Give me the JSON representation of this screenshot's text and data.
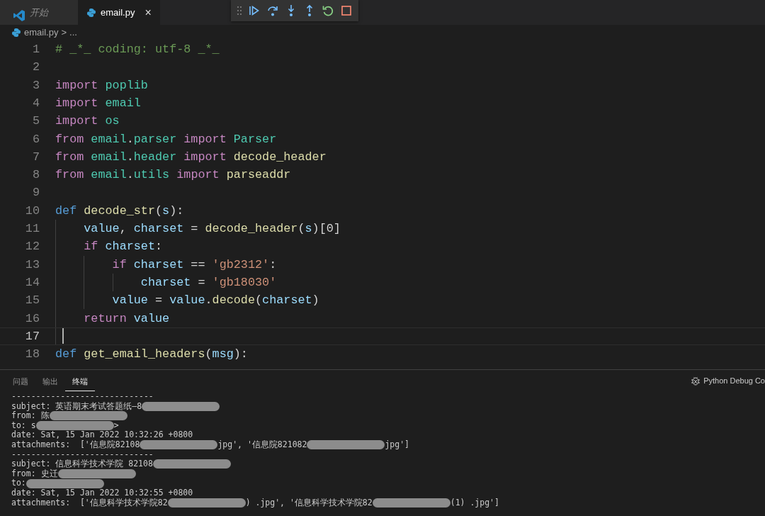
{
  "tabs": [
    {
      "label": "开始",
      "kind": "welcome",
      "selected": false
    },
    {
      "label": "email.py",
      "kind": "python",
      "selected": true,
      "close": "×"
    }
  ],
  "breadcrumb": {
    "file": "email.py",
    "separator": ">",
    "more": "..."
  },
  "editor": {
    "lines": [
      {
        "number": "1",
        "current": false,
        "tokens": [
          {
            "text": "# _*_ coding: utf-8 _*_",
            "kind": "comment"
          }
        ]
      },
      {
        "number": "2",
        "current": false
      },
      {
        "number": "3",
        "current": false,
        "tokens": [
          {
            "text": "import ",
            "kind": "keyword"
          },
          {
            "text": "poplib",
            "kind": "module"
          }
        ]
      },
      {
        "number": "4",
        "current": false,
        "tokens": [
          {
            "text": "import ",
            "kind": "keyword"
          },
          {
            "text": "email",
            "kind": "module"
          }
        ]
      },
      {
        "number": "5",
        "current": false,
        "tokens": [
          {
            "text": "import ",
            "kind": "keyword"
          },
          {
            "text": "os",
            "kind": "module"
          }
        ]
      },
      {
        "number": "6",
        "current": false,
        "tokens": [
          {
            "text": "from ",
            "kind": "keyword"
          },
          {
            "text": "email",
            "kind": "module"
          },
          {
            "text": ".",
            "kind": "plain"
          },
          {
            "text": "parser ",
            "kind": "module"
          },
          {
            "text": "import ",
            "kind": "keyword"
          },
          {
            "text": "Parser",
            "kind": "module"
          }
        ]
      },
      {
        "number": "7",
        "current": false,
        "tokens": [
          {
            "text": "from ",
            "kind": "keyword"
          },
          {
            "text": "email",
            "kind": "module"
          },
          {
            "text": ".",
            "kind": "plain"
          },
          {
            "text": "header ",
            "kind": "module"
          },
          {
            "text": "import ",
            "kind": "keyword"
          },
          {
            "text": "decode_header",
            "kind": "function"
          }
        ]
      },
      {
        "number": "8",
        "current": false,
        "tokens": [
          {
            "text": "from ",
            "kind": "keyword"
          },
          {
            "text": "email",
            "kind": "module"
          },
          {
            "text": ".",
            "kind": "plain"
          },
          {
            "text": "utils ",
            "kind": "module"
          },
          {
            "text": "import ",
            "kind": "keyword"
          },
          {
            "text": "parseaddr",
            "kind": "function"
          }
        ]
      },
      {
        "number": "9",
        "current": false
      },
      {
        "number": "10",
        "current": false,
        "tokens": [
          {
            "text": "def ",
            "kind": "storage"
          },
          {
            "text": "decode_str",
            "kind": "function"
          },
          {
            "text": "(",
            "kind": "plain"
          },
          {
            "text": "s",
            "kind": "variable"
          },
          {
            "text": "):",
            "kind": "plain"
          }
        ]
      },
      {
        "number": "11",
        "current": false,
        "tokens": [
          {
            "text": "    value",
            "kind": "variable"
          },
          {
            "text": ", ",
            "kind": "plain"
          },
          {
            "text": "charset",
            "kind": "variable"
          },
          {
            "text": " = ",
            "kind": "plain"
          },
          {
            "text": "decode_header",
            "kind": "function"
          },
          {
            "text": "(",
            "kind": "plain"
          },
          {
            "text": "s",
            "kind": "variable"
          },
          {
            "text": ")[0]",
            "kind": "plain"
          }
        ]
      },
      {
        "number": "12",
        "current": false,
        "tokens": [
          {
            "text": "    if ",
            "kind": "keyword"
          },
          {
            "text": "charset",
            "kind": "variable"
          },
          {
            "text": ":",
            "kind": "plain"
          }
        ]
      },
      {
        "number": "13",
        "current": false,
        "tokens": [
          {
            "text": "        if ",
            "kind": "keyword"
          },
          {
            "text": "charset",
            "kind": "variable"
          },
          {
            "text": " == ",
            "kind": "plain"
          },
          {
            "text": "'gb2312'",
            "kind": "string"
          },
          {
            "text": ":",
            "kind": "plain"
          }
        ]
      },
      {
        "number": "14",
        "current": false,
        "tokens": [
          {
            "text": "            charset",
            "kind": "variable"
          },
          {
            "text": " = ",
            "kind": "plain"
          },
          {
            "text": "'gb18030'",
            "kind": "string"
          }
        ]
      },
      {
        "number": "15",
        "current": false,
        "tokens": [
          {
            "text": "        value",
            "kind": "variable"
          },
          {
            "text": " = ",
            "kind": "plain"
          },
          {
            "text": "value",
            "kind": "variable"
          },
          {
            "text": ".",
            "kind": "plain"
          },
          {
            "text": "decode",
            "kind": "function"
          },
          {
            "text": "(",
            "kind": "plain"
          },
          {
            "text": "charset",
            "kind": "variable"
          },
          {
            "text": ")",
            "kind": "plain"
          }
        ]
      },
      {
        "number": "16",
        "current": false,
        "tokens": [
          {
            "text": "    return ",
            "kind": "keyword"
          },
          {
            "text": "value",
            "kind": "variable"
          }
        ]
      },
      {
        "number": "17",
        "current": true
      },
      {
        "number": "18",
        "current": false,
        "tokens": [
          {
            "text": "def ",
            "kind": "storage"
          },
          {
            "text": "get_email_headers",
            "kind": "function"
          },
          {
            "text": "(",
            "kind": "plain"
          },
          {
            "text": "msg",
            "kind": "variable"
          },
          {
            "text": "):",
            "kind": "plain"
          }
        ]
      }
    ]
  },
  "panel": {
    "tabs": [
      {
        "label": "问题",
        "selected": false
      },
      {
        "label": "输出",
        "selected": false
      },
      {
        "label": "终端",
        "selected": true
      }
    ],
    "terminal_name": "Python Debug Co",
    "terminal_lines": [
      [
        {
          "kind": "text",
          "text": "-----------------------------"
        }
      ],
      [
        {
          "kind": "text",
          "text": "subject: 英语期末考试答题纸—8"
        },
        {
          "kind": "redaction"
        }
      ],
      [
        {
          "kind": "text",
          "text": "from: 陈"
        },
        {
          "kind": "redaction"
        }
      ],
      [
        {
          "kind": "text",
          "text": "to: s"
        },
        {
          "kind": "redaction"
        },
        {
          "kind": "text",
          "text": ">"
        }
      ],
      [
        {
          "kind": "text",
          "text": "date: Sat, 15 Jan 2022 10:32:26 +0800"
        }
      ],
      [
        {
          "kind": "text",
          "text": "attachments:  ['信息院82108"
        },
        {
          "kind": "redaction"
        },
        {
          "kind": "text",
          "text": "jpg', '信息院821082"
        },
        {
          "kind": "redaction"
        },
        {
          "kind": "text",
          "text": "jpg']"
        }
      ],
      [
        {
          "kind": "text",
          "text": "-----------------------------"
        }
      ],
      [
        {
          "kind": "text",
          "text": "subject: 信息科学技术学院 82108"
        },
        {
          "kind": "redaction"
        }
      ],
      [
        {
          "kind": "text",
          "text": "from: 史迁"
        },
        {
          "kind": "redaction"
        }
      ],
      [
        {
          "kind": "text",
          "text": "to:"
        },
        {
          "kind": "redaction"
        }
      ],
      [
        {
          "kind": "text",
          "text": "date: Sat, 15 Jan 2022 10:32:55 +0800"
        }
      ],
      [
        {
          "kind": "text",
          "text": "attachments:  ['信息科学技术学院82"
        },
        {
          "kind": "redaction"
        },
        {
          "kind": "text",
          "text": ") .jpg', '信息科学技术学院82"
        },
        {
          "kind": "redaction"
        },
        {
          "kind": "text",
          "text": "(1) .jpg']"
        }
      ]
    ]
  }
}
